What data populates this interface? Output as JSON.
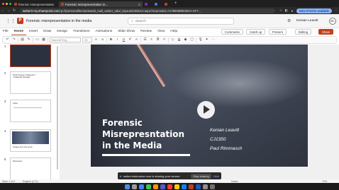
{
  "browser": {
    "tabs": [
      {
        "label": "forensic misrepresentation",
        "favicon": "#c43e1c",
        "active": false
      },
      {
        "label": "Forensic misrepresentation in...",
        "favicon": "#c43e1c",
        "active": true
      },
      {
        "label": "",
        "favicon": "#7b2cbf",
        "active": false
      },
      {
        "label": "",
        "favicon": "#3b78e7",
        "active": false
      },
      {
        "label": "",
        "favicon": "#c43e1c",
        "active": false
      }
    ],
    "url_host": "weber0-my.sharepoint.com",
    "url_path": "/:p:/r/personal/kenianleavitt_mail_weber_edu/_layouts/15/doc2.aspx?sourcedoc=%7BE8B9932DA-AF7...",
    "chrome_update": "New Chrome available"
  },
  "office": {
    "doc_title": "Forensic misrepresentation in the media",
    "search_placeholder": "Search",
    "user_name": "Kenian Leavitt",
    "avatar_initials": "KL"
  },
  "ribbon": {
    "tabs": [
      "File",
      "Home",
      "Insert",
      "Draw",
      "Design",
      "Transitions",
      "Animations",
      "Slide Show",
      "Review",
      "View",
      "Help"
    ],
    "active_tab": "Home",
    "comments": "Comments",
    "catchup": "Catch up",
    "present": "Present",
    "editing": "Editing",
    "share": "Share"
  },
  "toolbar": {
    "font": "Barrelli Reg...",
    "size": "28"
  },
  "thumbnails": [
    {
      "num": "1",
      "text": "",
      "dark": true
    },
    {
      "num": "2",
      "text": "NCIS Season 4 Episode 7\n\"Collateral Damage\"",
      "dark": false
    },
    {
      "num": "3",
      "text": "Video",
      "dark": false
    },
    {
      "num": "4",
      "text": "Images from the show",
      "dark": false
    },
    {
      "num": "5",
      "text": "Discussion",
      "dark": false
    }
  ],
  "slide": {
    "title": "Forensic\nMisrepresntation\nin the Media",
    "author": "Kenian Leavitt",
    "course": "CJ1350",
    "instructor": "Paul Rimmasch"
  },
  "share_banner": {
    "message": "weber.instructure.com is sharing your screen.",
    "stop": "Stop sharing",
    "hide": "Hide"
  },
  "status": {
    "slide_of": "Slide 1 of 5",
    "language": "English (U.S.)",
    "notes": "Notes",
    "zoom": "72%"
  }
}
